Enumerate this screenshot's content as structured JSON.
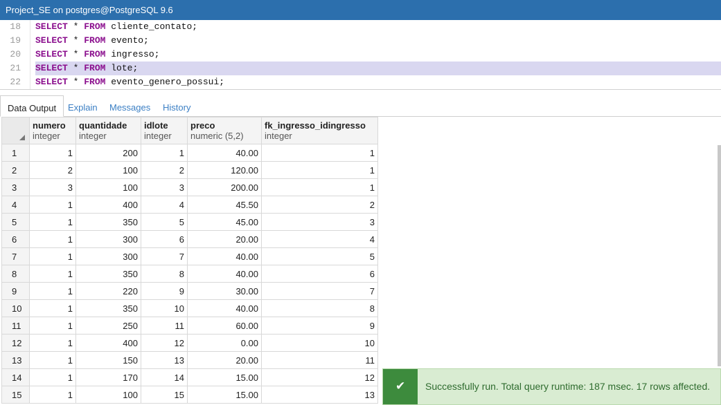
{
  "window": {
    "title": "Project_SE on postgres@PostgreSQL 9.6"
  },
  "editor": {
    "lines": [
      {
        "num": "18",
        "kw1": "SELECT",
        "star": " * ",
        "kw2": "FROM",
        "rest": " cliente_contato;"
      },
      {
        "num": "19",
        "kw1": "SELECT",
        "star": " * ",
        "kw2": "FROM",
        "rest": " evento;"
      },
      {
        "num": "20",
        "kw1": "SELECT",
        "star": " * ",
        "kw2": "FROM",
        "rest": " ingresso;"
      },
      {
        "num": "21",
        "kw1": "SELECT",
        "star": " * ",
        "kw2": "FROM",
        "rest": " lote;"
      },
      {
        "num": "22",
        "kw1": "SELECT",
        "star": " * ",
        "kw2": "FROM",
        "rest": " evento_genero_possui;"
      }
    ]
  },
  "tabs": {
    "data_output": "Data Output",
    "explain": "Explain",
    "messages": "Messages",
    "history": "History"
  },
  "grid": {
    "columns": [
      {
        "name": "numero",
        "type": "integer"
      },
      {
        "name": "quantidade",
        "type": "integer"
      },
      {
        "name": "idlote",
        "type": "integer"
      },
      {
        "name": "preco",
        "type": "numeric (5,2)"
      },
      {
        "name": "fk_ingresso_idingresso",
        "type": "integer"
      }
    ],
    "rows": [
      [
        "1",
        "1",
        "200",
        "1",
        "40.00",
        "1"
      ],
      [
        "2",
        "2",
        "100",
        "2",
        "120.00",
        "1"
      ],
      [
        "3",
        "3",
        "100",
        "3",
        "200.00",
        "1"
      ],
      [
        "4",
        "1",
        "400",
        "4",
        "45.50",
        "2"
      ],
      [
        "5",
        "1",
        "350",
        "5",
        "45.00",
        "3"
      ],
      [
        "6",
        "1",
        "300",
        "6",
        "20.00",
        "4"
      ],
      [
        "7",
        "1",
        "300",
        "7",
        "40.00",
        "5"
      ],
      [
        "8",
        "1",
        "350",
        "8",
        "40.00",
        "6"
      ],
      [
        "9",
        "1",
        "220",
        "9",
        "30.00",
        "7"
      ],
      [
        "10",
        "1",
        "350",
        "10",
        "40.00",
        "8"
      ],
      [
        "11",
        "1",
        "250",
        "11",
        "60.00",
        "9"
      ],
      [
        "12",
        "1",
        "400",
        "12",
        "0.00",
        "10"
      ],
      [
        "13",
        "1",
        "150",
        "13",
        "20.00",
        "11"
      ],
      [
        "14",
        "1",
        "170",
        "14",
        "15.00",
        "12"
      ],
      [
        "15",
        "1",
        "100",
        "15",
        "15.00",
        "13"
      ]
    ]
  },
  "toast": {
    "icon": "check-icon",
    "message": "Successfully run. Total query runtime: 187 msec. 17 rows affected."
  },
  "colors": {
    "titlebar": "#2c6fad",
    "keyword": "#8b0f8e",
    "active_line": "#d9d7f0",
    "tab_link": "#3b7fc4",
    "toast_bg": "#d9ecd2",
    "toast_icon_bg": "#3d8b3d"
  }
}
